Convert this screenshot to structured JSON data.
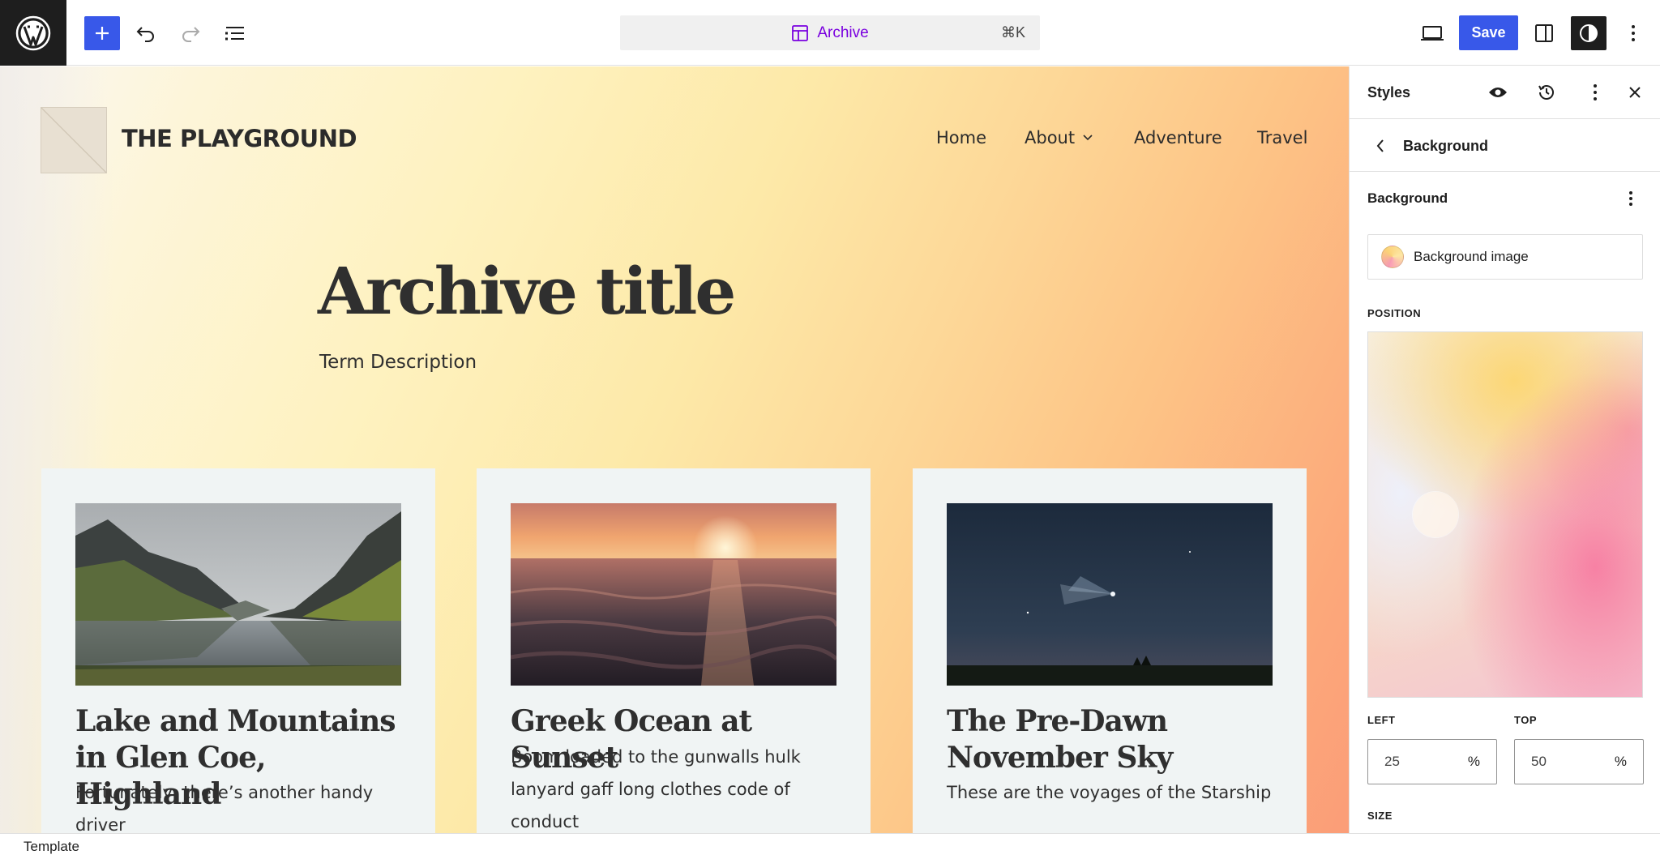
{
  "toolbar": {
    "command_label": "Archive",
    "command_shortcut": "⌘K",
    "save_label": "Save",
    "icons": [
      "wordpress-icon",
      "plus-icon",
      "undo-icon",
      "redo-icon",
      "list-view-icon",
      "template-icon",
      "desktop-view-icon",
      "sidebar-settings-icon",
      "styles-contrast-icon",
      "more-vertical-icon"
    ]
  },
  "site": {
    "title": "THE PLAYGROUND",
    "nav": [
      "Home",
      "About",
      "Adventure",
      "Travel"
    ]
  },
  "archive": {
    "title": "Archive title",
    "description": "Term Description"
  },
  "posts": [
    {
      "title": "Lake and Mountains in Glen Coe, Highland",
      "excerpt": "Fortunately, there’s another handy driver"
    },
    {
      "title": "Greek Ocean at Sunset",
      "excerpt": "Boom loaded to the gunwalls hulk lanyard gaff long clothes code of conduct"
    },
    {
      "title": "The Pre-Dawn November Sky",
      "excerpt": "These are the voyages of the Starship"
    }
  ],
  "sidebar": {
    "title": "Styles",
    "nav_title": "Background",
    "section_heading": "Background",
    "bg_image_label": "Background image",
    "position_label": "POSITION",
    "left_label": "LEFT",
    "top_label": "TOP",
    "left_value": "25",
    "top_value": "50",
    "unit": "%",
    "size_label": "SIZE",
    "focal_point": {
      "x_percent": 25,
      "y_percent": 50
    }
  },
  "footer": {
    "breadcrumb": "Template"
  },
  "colors": {
    "accent": "#3858e9",
    "command_accent": "#7a00df",
    "dark": "#1e1e1e"
  }
}
